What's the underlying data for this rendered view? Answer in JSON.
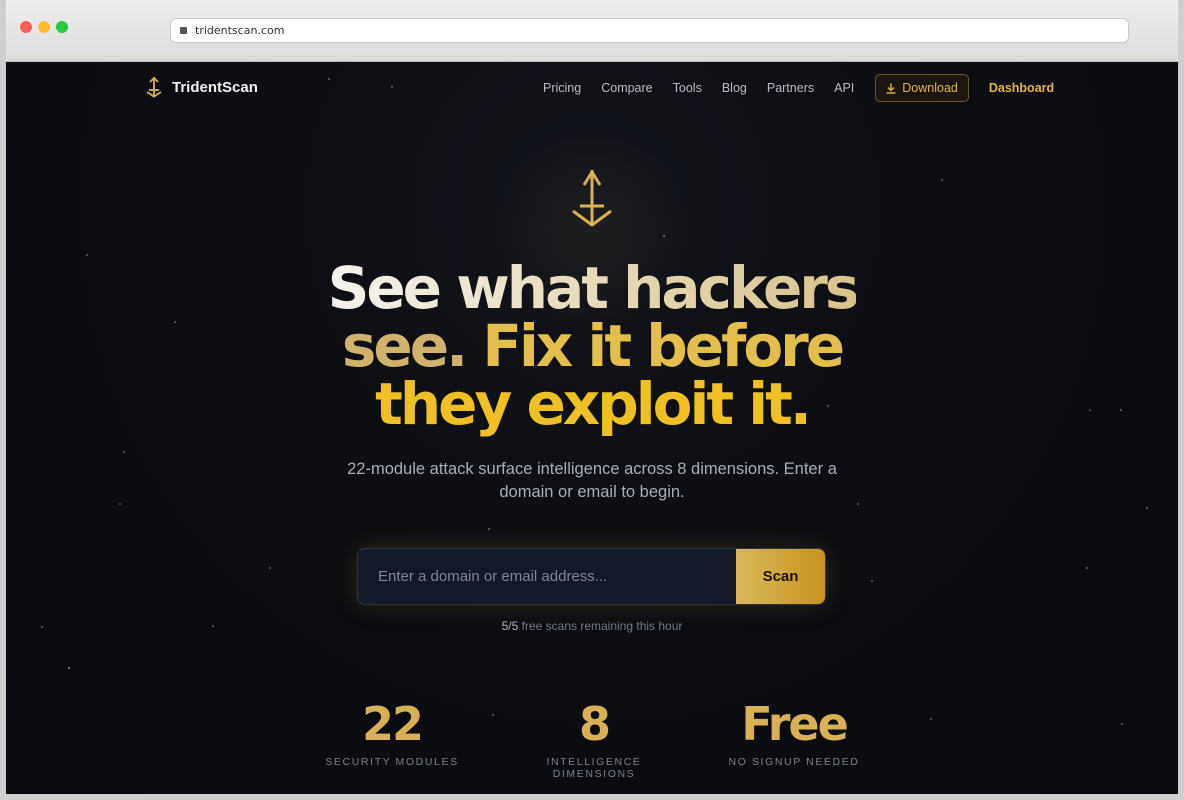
{
  "browser": {
    "url": "tridentscan.com"
  },
  "nav": {
    "brand": "TridentScan",
    "links": [
      "Pricing",
      "Compare",
      "Tools",
      "Blog",
      "Partners",
      "API"
    ],
    "download_label": "Download",
    "dashboard_label": "Dashboard"
  },
  "hero": {
    "line1": "See what hackers",
    "line2a": "see.",
    "line2b": "Fix it before",
    "line3": "they exploit it.",
    "subtitle": "22-module attack surface intelligence across 8 dimensions. Enter a domain or email to begin."
  },
  "search": {
    "placeholder": "Enter a domain or email address...",
    "button_label": "Scan",
    "remaining_count": "5/5",
    "remaining_text": "free scans remaining this hour"
  },
  "stats": [
    {
      "value": "22",
      "label": "SECURITY MODULES"
    },
    {
      "value": "8",
      "label": "INTELLIGENCE DIMENSIONS"
    },
    {
      "value": "Free",
      "label": "NO SIGNUP NEEDED"
    }
  ],
  "colors": {
    "accent": "#d7b156",
    "background": "#0c0d12",
    "headline_gold": "#eec024"
  },
  "icons": [
    "trident-icon",
    "download-icon"
  ]
}
